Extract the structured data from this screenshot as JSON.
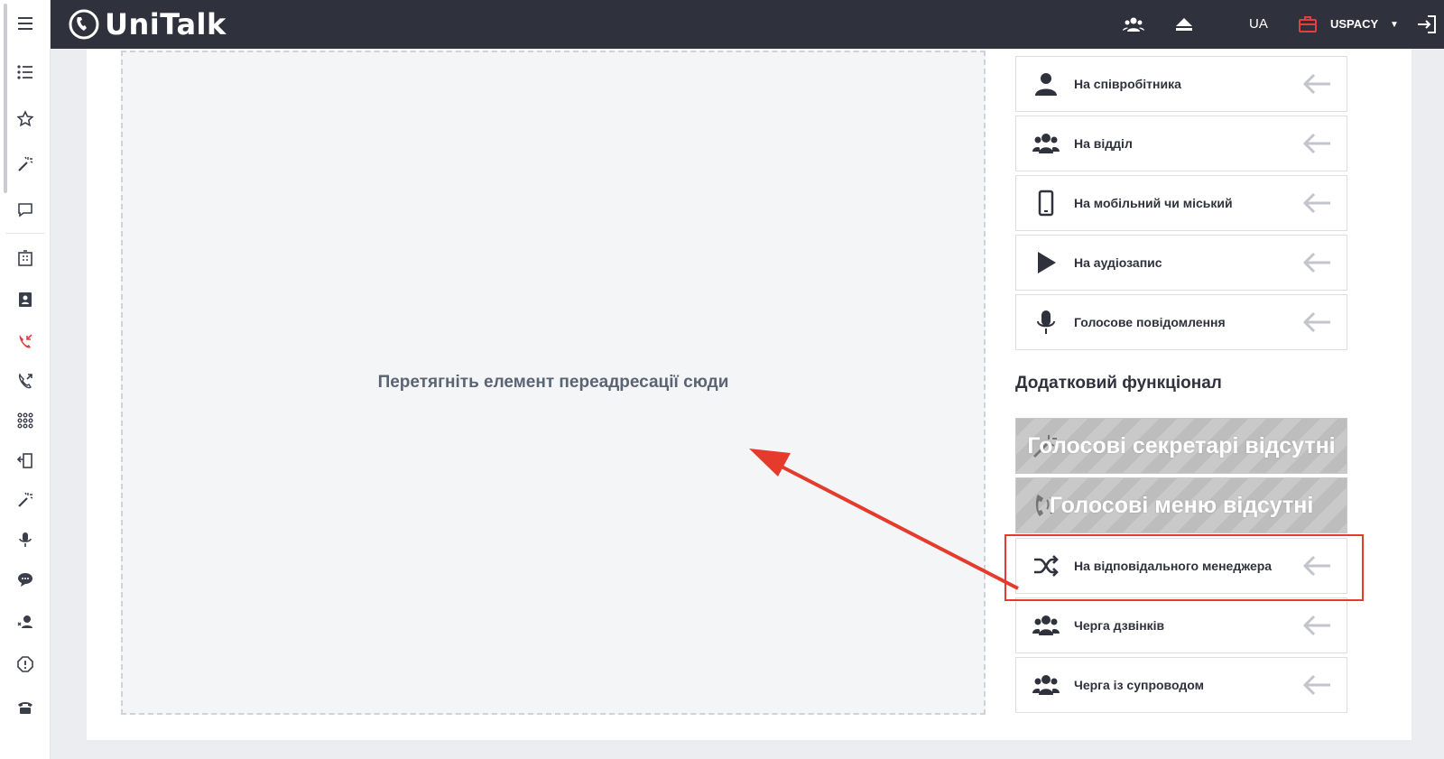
{
  "app": {
    "logo_text": "UniTalk"
  },
  "topbar": {
    "lang": "UA",
    "company": "USPACY"
  },
  "sidebar": {
    "icons": [
      "menu-icon",
      "list-icon",
      "star-icon",
      "magic-wand-icon",
      "chat-bubble-icon",
      "building-icon",
      "contacts-icon",
      "incoming-call-icon",
      "outgoing-call-icon",
      "dialpad-icon",
      "phone-forward-icon",
      "magic-wand-icon",
      "microphone-icon",
      "message-icon",
      "support-agent-icon",
      "alert-icon",
      "desk-phone-icon"
    ]
  },
  "dropzone": {
    "text": "Перетягніть елемент переадресації сюди"
  },
  "items": [
    {
      "label": "На співробітника",
      "icon": "person-icon"
    },
    {
      "label": "На відділ",
      "icon": "group-icon"
    },
    {
      "label": "На мобільний чи міський",
      "icon": "mobile-icon"
    },
    {
      "label": "На аудіозапис",
      "icon": "play-icon"
    },
    {
      "label": "Голосове повідомлення",
      "icon": "microphone-icon"
    }
  ],
  "section_title": "Додатковий функціонал",
  "disabled_items": [
    {
      "overlay": "Голосові секретарі відсутні",
      "icon": "voice-secretary-icon"
    },
    {
      "overlay": "Голосові меню відсутні",
      "icon": "voice-menu-icon"
    }
  ],
  "extra_items": [
    {
      "label": "На відповідального менеджера",
      "icon": "shuffle-icon"
    },
    {
      "label": "Черга дзвінків",
      "icon": "group-icon"
    },
    {
      "label": "Черга із супроводом",
      "icon": "group-icon"
    }
  ],
  "colors": {
    "topbar": "#2f323c",
    "accent_red": "#e53b2c"
  }
}
